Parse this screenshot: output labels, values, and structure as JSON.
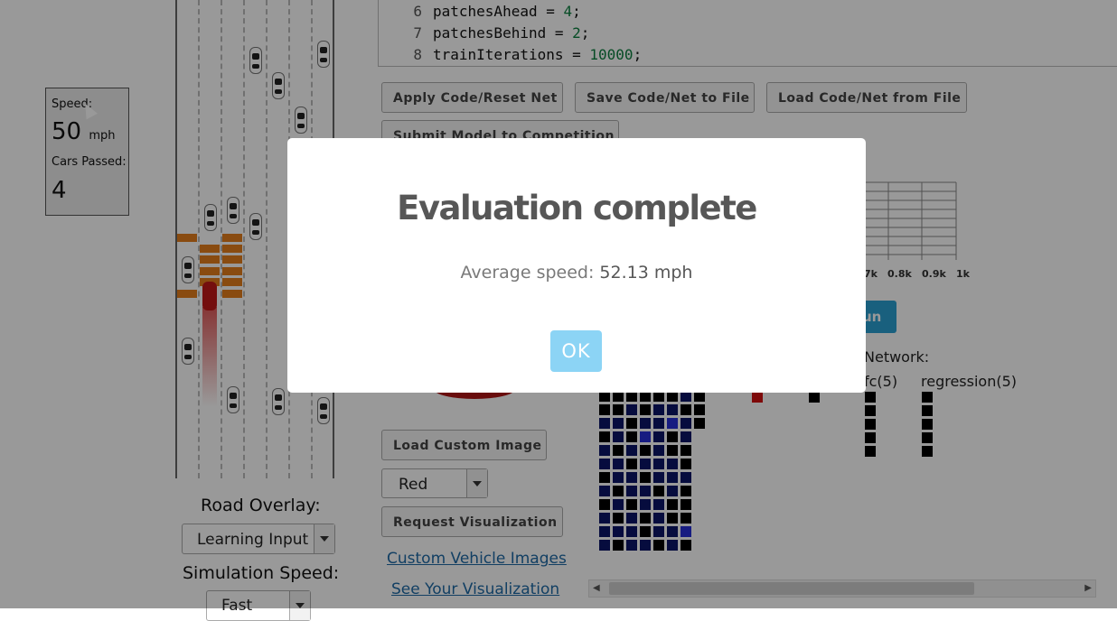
{
  "stats": {
    "speed_label": "Speed:",
    "speed_value": "50",
    "speed_unit": "mph",
    "passed_label": "Cars Passed:",
    "passed_value": "4"
  },
  "road": {
    "overlay_label": "Road Overlay:",
    "overlay_value": "Learning Input",
    "speed_label": "Simulation Speed:",
    "speed_value": "Fast"
  },
  "code": {
    "lines": [
      {
        "num": "6",
        "pre": "patchesAhead = ",
        "val": "4",
        "post": ";"
      },
      {
        "num": "7",
        "pre": "patchesBehind = ",
        "val": "2",
        "post": ";"
      },
      {
        "num": "8",
        "pre": "trainIterations = ",
        "val": "10000",
        "post": ";"
      }
    ]
  },
  "buttons": {
    "apply": "Apply Code/Reset Net",
    "save": "Save Code/Net to File",
    "load": "Load Code/Net from File",
    "submit": "Submit Model to Competition",
    "load_image": "Load Custom Image",
    "request_vis": "Request Visualization",
    "run": "un"
  },
  "vehicle": {
    "color_value": "Red"
  },
  "links": {
    "custom_images": "Custom Vehicle Images",
    "see_vis": "See Your Visualization"
  },
  "chart_ticks": [
    "7k",
    "0.8k",
    "0.9k",
    "1k"
  ],
  "network": {
    "title": "Network:",
    "fc_label": "fc(5)",
    "regression_label": "regression(5)"
  },
  "modal": {
    "title": "Evaluation complete",
    "text_prefix": "Average speed: ",
    "text_value": "52.13 mph",
    "ok_label": "OK"
  },
  "colors": {
    "modal_ok": "#8cd4f5",
    "brick": "#e57e1c",
    "ego_car": "#c21818",
    "run_button": "#2aa1d3"
  }
}
